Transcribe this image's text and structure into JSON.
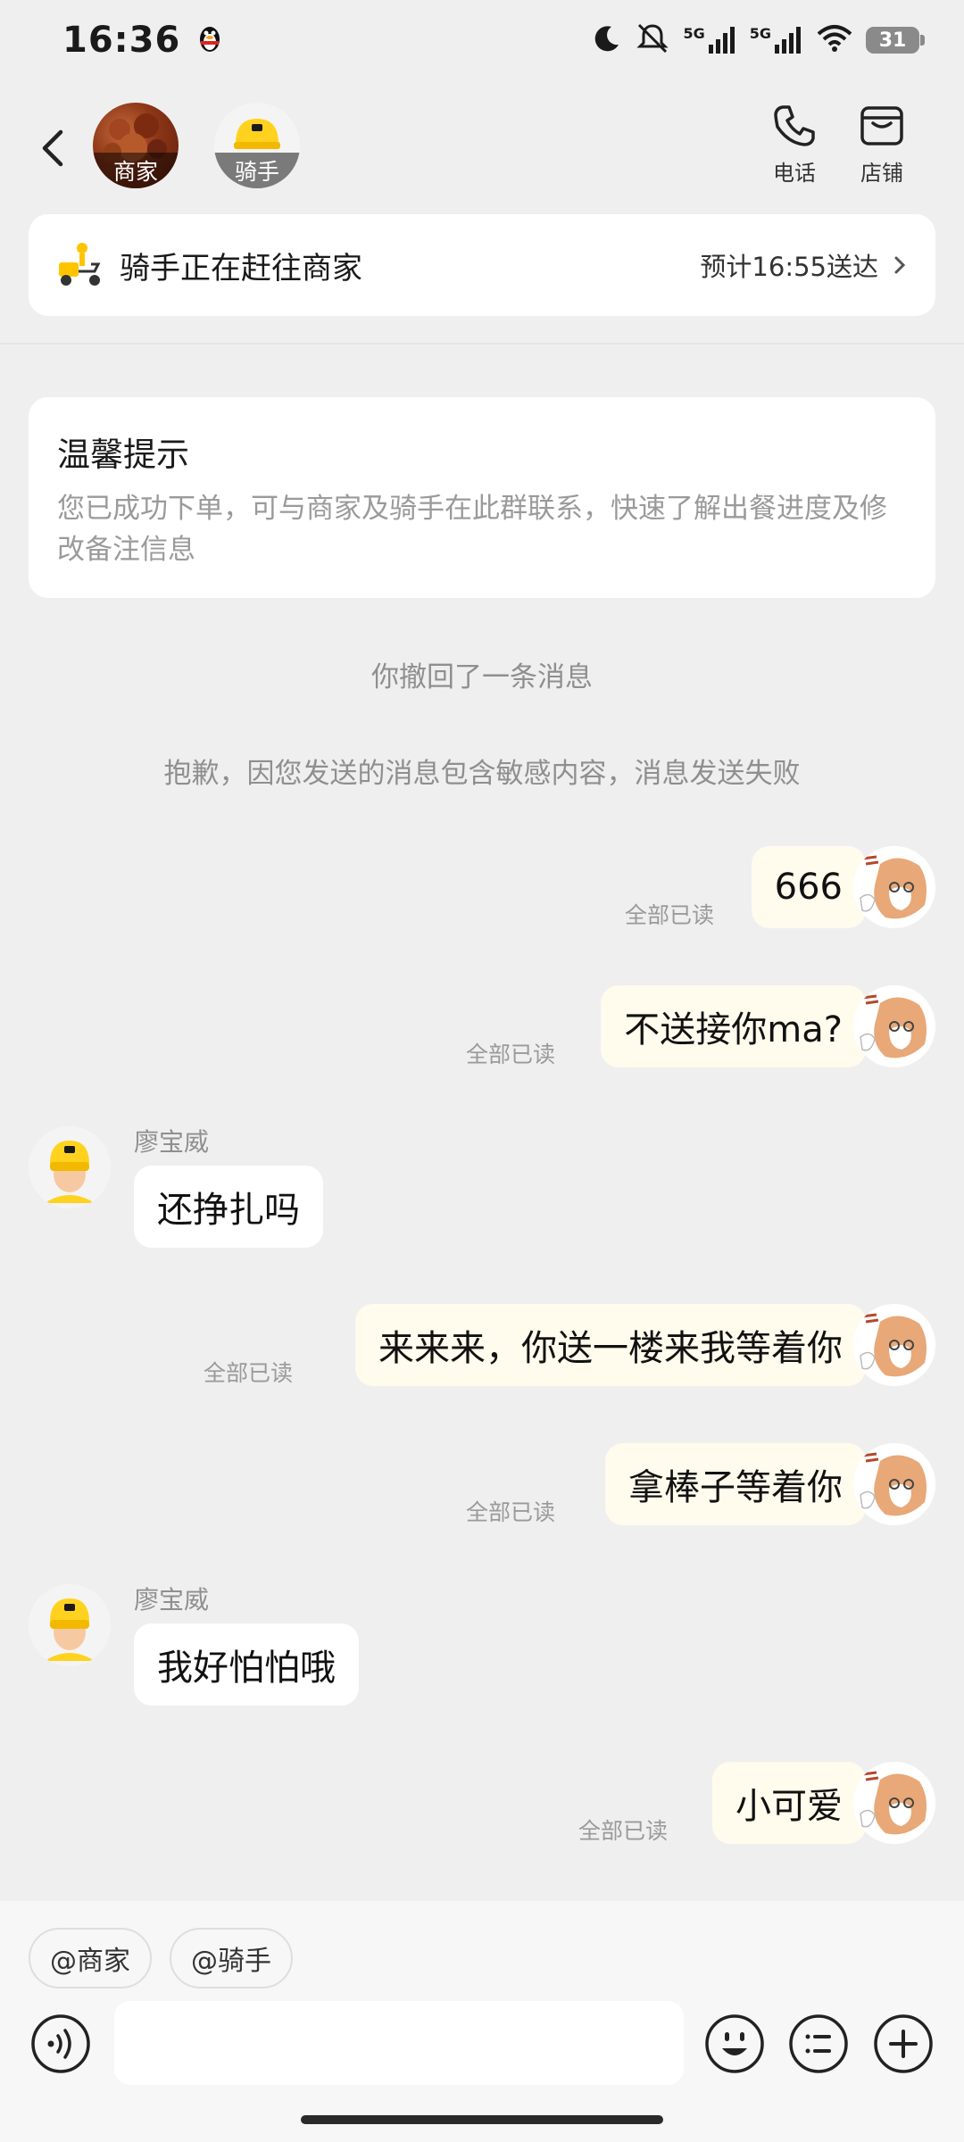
{
  "status_bar": {
    "time": "16:36",
    "network_1": "5G",
    "network_2": "5G",
    "battery": "31"
  },
  "header": {
    "merchant_avatar_label": "商家",
    "rider_avatar_label": "骑手",
    "phone_label": "电话",
    "shop_label": "店铺"
  },
  "delivery": {
    "status": "骑手正在赶往商家",
    "eta": "预计16:55送达"
  },
  "tip": {
    "title": "温馨提示",
    "body": "您已成功下单，可与商家及骑手在此群联系，快速了解出餐进度及修改备注信息"
  },
  "system_messages": [
    "你撤回了一条消息",
    "抱歉，因您发送的消息包含敏感内容，消息发送失败"
  ],
  "messages": [
    {
      "side": "out",
      "text": "666",
      "read": "全部已读"
    },
    {
      "side": "out",
      "text": "不送接你ma?",
      "read": "全部已读"
    },
    {
      "side": "in",
      "sender": "廖宝威",
      "text": "还挣扎吗"
    },
    {
      "side": "out",
      "text": "来来来，你送一楼来我等着你",
      "read": "全部已读"
    },
    {
      "side": "out",
      "text": "拿棒子等着你",
      "read": "全部已读"
    },
    {
      "side": "in",
      "sender": "廖宝威",
      "text": "我好怕怕哦"
    },
    {
      "side": "out",
      "text": "小可爱",
      "read": "全部已读"
    }
  ],
  "composer": {
    "mention_merchant": "@商家",
    "mention_rider": "@骑手",
    "placeholder": ""
  },
  "icons": {
    "back": "chevron-left-icon",
    "phone": "phone-icon",
    "shop": "shop-icon",
    "scooter": "delivery-scooter-icon",
    "voice": "voice-icon",
    "emoji": "emoji-icon",
    "quick_reply": "list-icon",
    "more": "plus-icon"
  },
  "colors": {
    "background": "#efeff0",
    "outgoing_bubble": "#fffbed",
    "incoming_bubble": "#ffffff",
    "rider_yellow": "#ffd21f"
  }
}
